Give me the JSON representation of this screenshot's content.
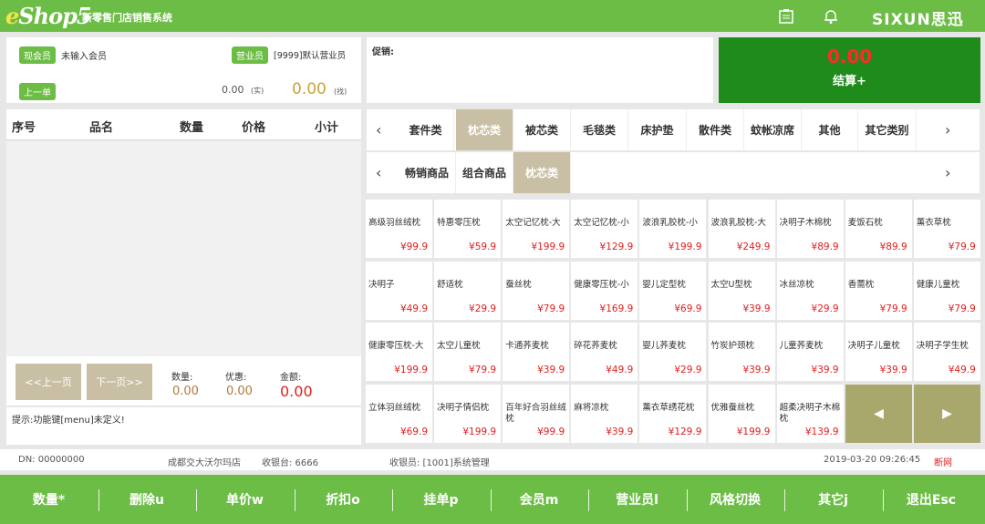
{
  "header": {
    "logo": "Shop5",
    "logo_e": "e",
    "subtitle": "新零售门店销售系统",
    "brand": "SIXUN思迅"
  },
  "member": {
    "tag": "现会员",
    "value": "未输入会员",
    "sales_tag": "营业员",
    "sales_value": "[9999]默认营业员",
    "prev_tag": "上一单",
    "prev_amount": "0.00",
    "prev_unit": "(实)",
    "change_amount": "0.00",
    "change_unit": "(找)"
  },
  "promo": {
    "label": "促销:"
  },
  "checkout": {
    "amount": "0.00",
    "label": "结算+"
  },
  "table": {
    "headers": [
      "序号",
      "品名",
      "数量",
      "价格",
      "小计"
    ]
  },
  "pager": {
    "prev": "<<上一页",
    "next": "下一页>>"
  },
  "summary": {
    "qty_label": "数量:",
    "qty": "0.00",
    "disc_label": "优惠:",
    "disc": "0.00",
    "total_label": "金额:",
    "total": "0.00"
  },
  "hint": "提示:功能键[menu]未定义!",
  "categories": [
    "套件类",
    "枕芯类",
    "被芯类",
    "毛毯类",
    "床护垫",
    "散件类",
    "蚊帐凉席",
    "其他",
    "其它类别"
  ],
  "subcategories": [
    "畅销商品",
    "组合商品",
    "枕芯类"
  ],
  "products": [
    {
      "name": "高级羽丝绒枕",
      "price": "¥99.9"
    },
    {
      "name": "特惠零压枕",
      "price": "¥59.9"
    },
    {
      "name": "太空记忆枕-大",
      "price": "¥199.9"
    },
    {
      "name": "太空记忆枕-小",
      "price": "¥129.9"
    },
    {
      "name": "波浪乳胶枕-小",
      "price": "¥199.9"
    },
    {
      "name": "波浪乳胶枕-大",
      "price": "¥249.9"
    },
    {
      "name": "决明子木棉枕",
      "price": "¥89.9"
    },
    {
      "name": "麦饭石枕",
      "price": "¥89.9"
    },
    {
      "name": "薰衣草枕",
      "price": "¥79.9"
    },
    {
      "name": "决明子",
      "price": "¥49.9"
    },
    {
      "name": "舒适枕",
      "price": "¥29.9"
    },
    {
      "name": "蚕丝枕",
      "price": "¥79.9"
    },
    {
      "name": "健康零压枕-小",
      "price": "¥169.9"
    },
    {
      "name": "婴儿定型枕",
      "price": "¥69.9"
    },
    {
      "name": "太空U型枕",
      "price": "¥39.9"
    },
    {
      "name": "冰丝凉枕",
      "price": "¥29.9"
    },
    {
      "name": "香薷枕",
      "price": "¥79.9"
    },
    {
      "name": "健康儿童枕",
      "price": "¥79.9"
    },
    {
      "name": "健康零压枕-大",
      "price": "¥199.9"
    },
    {
      "name": "太空儿童枕",
      "price": "¥79.9"
    },
    {
      "name": "卡通荞麦枕",
      "price": "¥39.9"
    },
    {
      "name": "碎花荞麦枕",
      "price": "¥49.9"
    },
    {
      "name": "婴儿荞麦枕",
      "price": "¥29.9"
    },
    {
      "name": "竹炭护颈枕",
      "price": "¥39.9"
    },
    {
      "name": "儿童荞麦枕",
      "price": "¥39.9"
    },
    {
      "name": "决明子儿童枕",
      "price": "¥39.9"
    },
    {
      "name": "决明子学生枕",
      "price": "¥49.9"
    },
    {
      "name": "立体羽丝绒枕",
      "price": "¥69.9"
    },
    {
      "name": "决明子情侣枕",
      "price": "¥199.9"
    },
    {
      "name": "百年好合羽丝绒枕",
      "price": "¥99.9"
    },
    {
      "name": "麻将凉枕",
      "price": "¥39.9"
    },
    {
      "name": "薰衣草绣花枕",
      "price": "¥129.9"
    },
    {
      "name": "优雅蚕丝枕",
      "price": "¥199.9"
    },
    {
      "name": "超柔决明子木棉枕",
      "price": "¥139.9"
    }
  ],
  "status": {
    "dn": "DN: 00000000",
    "store": "成都交大沃尔玛店",
    "till": "收银台: 6666",
    "cashier": "收银员: [1001]系统管理",
    "datetime": "2019-03-20 09:26:45",
    "network": "断网"
  },
  "functions": [
    "数量*",
    "删除u",
    "单价w",
    "折扣o",
    "挂单p",
    "会员m",
    "营业员l",
    "风格切换",
    "其它j",
    "退出Esc"
  ],
  "colors": {
    "accent": "#6cbd45",
    "checkout_bg": "#1f8b1b",
    "price": "#e02020",
    "tab_active": "#c9bfa4"
  }
}
